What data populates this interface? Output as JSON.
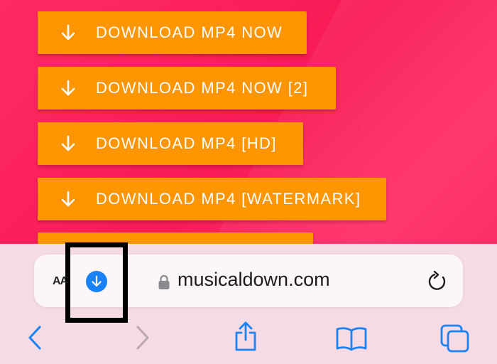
{
  "downloads": [
    {
      "label": "DOWNLOAD MP4 NOW"
    },
    {
      "label": "DOWNLOAD MP4 NOW [2]"
    },
    {
      "label": "DOWNLOAD MP4 [HD]"
    },
    {
      "label": "DOWNLOAD MP4 [WATERMARK]"
    }
  ],
  "address_bar": {
    "reader_label": "AA",
    "url": "musicaldown.com"
  },
  "icons": {
    "button_arrow": "arrow-down-icon",
    "download_indicator": "download-circle-icon",
    "lock": "lock-icon",
    "reload": "reload-icon",
    "back": "chevron-left-icon",
    "forward": "chevron-right-icon",
    "share": "share-icon",
    "bookmarks": "book-icon",
    "tabs": "tabs-icon"
  },
  "colors": {
    "page_background": "#f91f57",
    "button": "#ff9500",
    "safari_accent": "#1a82f7",
    "toolbar": "#f6dbe4"
  }
}
